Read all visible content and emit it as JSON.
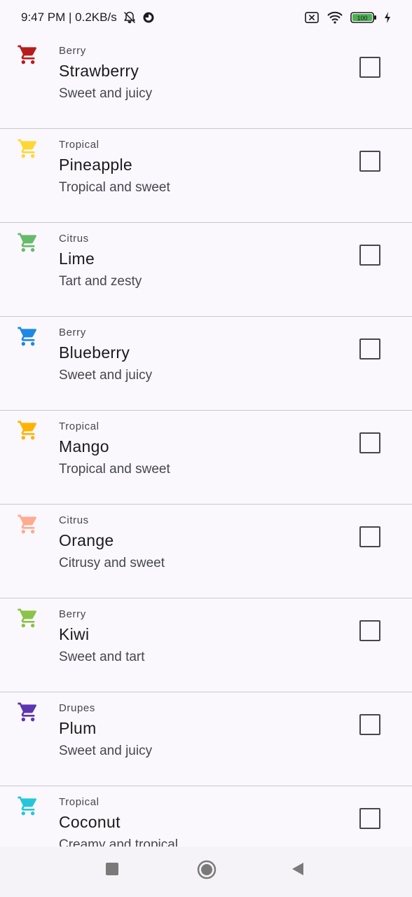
{
  "status_bar": {
    "time_speed": "9:47 PM | 0.2KB/s",
    "battery": "100"
  },
  "items": [
    {
      "category": "Berry",
      "name": "Strawberry",
      "description": "Sweet and juicy",
      "icon": "cart-icon",
      "color": "#b71c1c"
    },
    {
      "category": "Tropical",
      "name": "Pineapple",
      "description": "Tropical and sweet",
      "icon": "cart-icon",
      "color": "#fdd835"
    },
    {
      "category": "Citrus",
      "name": "Lime",
      "description": "Tart and zesty",
      "icon": "cart-icon",
      "color": "#66bb6a"
    },
    {
      "category": "Berry",
      "name": "Blueberry",
      "description": "Sweet and juicy",
      "icon": "cart-icon",
      "color": "#1e88e5"
    },
    {
      "category": "Tropical",
      "name": "Mango",
      "description": "Tropical and sweet",
      "icon": "cart-icon",
      "color": "#ffb300"
    },
    {
      "category": "Citrus",
      "name": "Orange",
      "description": "Citrusy and sweet",
      "icon": "cart-icon",
      "color": "#ffab91"
    },
    {
      "category": "Berry",
      "name": "Kiwi",
      "description": "Sweet and tart",
      "icon": "cart-icon",
      "color": "#8bc34a"
    },
    {
      "category": "Drupes",
      "name": "Plum",
      "description": "Sweet and juicy",
      "icon": "cart-icon",
      "color": "#5e35b1"
    },
    {
      "category": "Tropical",
      "name": "Coconut",
      "description": "Creamy and tropical",
      "icon": "cart-icon",
      "color": "#26c6da"
    }
  ],
  "nav": {
    "buttons": [
      "recents-button",
      "home-button",
      "back-button"
    ]
  }
}
